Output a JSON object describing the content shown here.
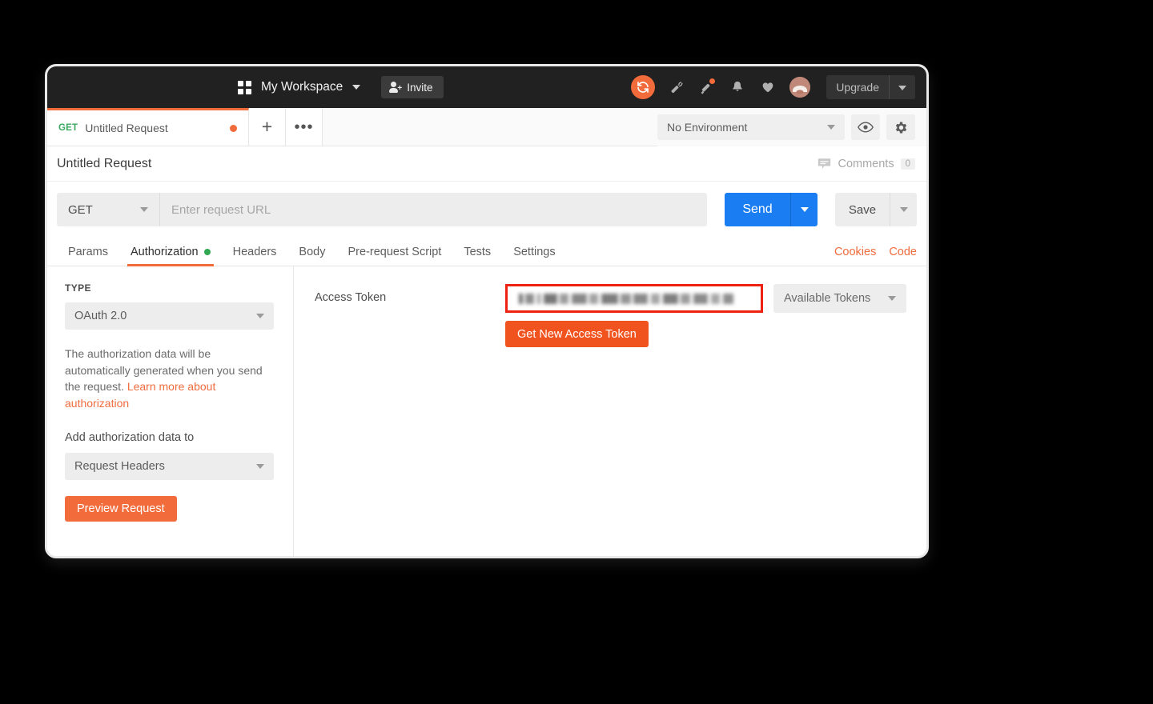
{
  "topbar": {
    "grid_icon": "apps-grid-icon",
    "workspace_name": "My Workspace",
    "workspace_caret": "chevron-down-icon",
    "invite_label": "Invite",
    "invite_icon": "person-add-icon",
    "icons": {
      "sync": "sync-icon",
      "satellite": "satellite-dish-icon",
      "announcement": "megaphone-icon",
      "notifications": "bell-icon",
      "favorites": "heart-icon",
      "avatar": "user-avatar"
    },
    "upgrade_label": "Upgrade",
    "upgrade_caret": "chevron-down-icon",
    "background": "#212121",
    "accent": "#f26b3a"
  },
  "tabs": {
    "request_tab": {
      "method": "GET",
      "name": "Untitled Request",
      "unsaved_indicator": "unsaved-dot"
    },
    "new_tab_icon": "plus-icon",
    "more_tabs_icon": "ellipsis-icon",
    "environment": {
      "selected": "No Environment",
      "caret": "chevron-down-icon"
    },
    "eye_icon": "eye-icon",
    "settings_icon": "gear-icon"
  },
  "request": {
    "title": "Untitled Request",
    "comments_label": "Comments",
    "comments_count": "0",
    "comments_icon": "comment-icon",
    "method": "GET",
    "url_placeholder": "Enter request URL",
    "url_value": "",
    "send_label": "Send",
    "send_color": "#1a7ef2",
    "save_label": "Save"
  },
  "section_tabs": {
    "items": [
      {
        "label": "Params",
        "active": false,
        "dot": false
      },
      {
        "label": "Authorization",
        "active": true,
        "dot": true
      },
      {
        "label": "Headers",
        "active": false,
        "dot": false
      },
      {
        "label": "Body",
        "active": false,
        "dot": false
      },
      {
        "label": "Pre-request Script",
        "active": false,
        "dot": false
      },
      {
        "label": "Tests",
        "active": false,
        "dot": false
      },
      {
        "label": "Settings",
        "active": false,
        "dot": false
      }
    ],
    "cookies_label": "Cookies",
    "code_label": "Code",
    "link_color": "#ef6c3e",
    "active_underline": "#f26b3a",
    "dot_color": "#2fa84f"
  },
  "auth_panel": {
    "type_label": "TYPE",
    "type_value": "OAuth 2.0",
    "help_text_1": "The authorization data will be automatically generated when you send the request. ",
    "help_link": "Learn more about authorization",
    "add_data_label": "Add authorization data to",
    "add_data_value": "Request Headers",
    "preview_button": "Preview Request",
    "preview_color": "#f26b3a"
  },
  "token_panel": {
    "access_token_label": "Access Token",
    "access_token_value": "",
    "access_token_redacted": true,
    "highlight_color": "#ee2211",
    "available_tokens_label": "Available Tokens",
    "get_new_token_label": "Get New Access Token",
    "get_new_token_color": "#f1531f"
  }
}
